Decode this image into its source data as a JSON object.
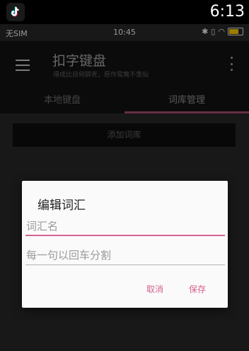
{
  "host": {
    "time": "6:13",
    "app_icon": "tiktok-icon"
  },
  "status_bar": {
    "carrier": "无SIM",
    "time": "10:45",
    "icons": [
      "bluetooth-icon",
      "vibrate-icon",
      "wifi-icon",
      "battery-icon"
    ]
  },
  "appbar": {
    "title": "扣字键盘",
    "subtitle": "得成比目何辞死，愿作鸳鸯不羡仙",
    "menu_icon": "menu-icon",
    "overflow_icon": "more-vert-icon"
  },
  "tabs": [
    {
      "label": "本地键盘",
      "active": false
    },
    {
      "label": "词库管理",
      "active": true
    }
  ],
  "content": {
    "add_button": "添加词库"
  },
  "dialog": {
    "title": "编辑词汇",
    "name_field": {
      "placeholder": "词汇名",
      "value": ""
    },
    "content_field": {
      "placeholder": "每一句以回车分割",
      "value": ""
    },
    "cancel": "取消",
    "save": "保存"
  },
  "colors": {
    "accent": "#d4628f",
    "appbar": "#111111",
    "background": "#262626"
  }
}
